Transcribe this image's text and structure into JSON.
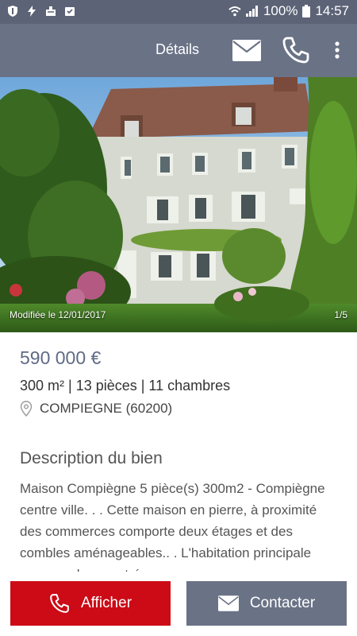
{
  "status_bar": {
    "battery": "100%",
    "time": "14:57",
    "icons": [
      "shield-icon",
      "flash-icon",
      "cleaner-icon",
      "clipboard-check-icon",
      "wifi-icon",
      "signal-icon",
      "battery-icon"
    ]
  },
  "app_bar": {
    "title": "Détails",
    "icons": [
      "mail-icon",
      "phone-icon",
      "more-vert-icon"
    ]
  },
  "listing": {
    "modified": "Modifiée le 12/01/2017",
    "photo_counter": "1/5",
    "price": "590 000 €",
    "specs": "300 m² | 13 pièces | 11 chambres",
    "location": "COMPIEGNE (60200)"
  },
  "description": {
    "title": "Description du bien",
    "text": "Maison Compiègne 5 pièce(s) 300m2 - Compiègne centre ville. . . Cette maison en pierre, à proximité des commerces comporte deux étages et des combles aménageables.. . L'habitation principale comprend une entrée"
  },
  "actions": {
    "show_label": "Afficher",
    "contact_label": "Contacter"
  },
  "colors": {
    "status_bar": "#5c6376",
    "app_bar": "#6a7286",
    "price": "#5f6a86",
    "primary_button": "#cc0b16",
    "secondary_button": "#6a7286"
  }
}
